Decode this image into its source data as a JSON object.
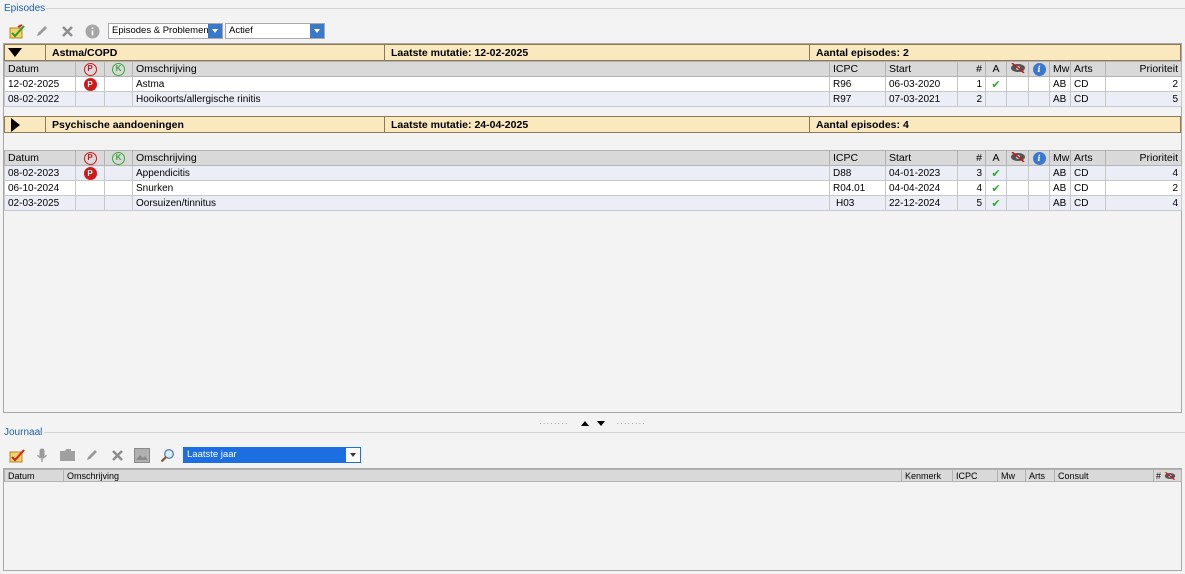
{
  "episodes_section": {
    "title": "Episodes",
    "toolbar": {
      "icons": [
        "new-episode-icon",
        "edit-pencil-icon",
        "delete-x-icon",
        "info-grey-icon"
      ],
      "filter_type": "Episodes & Problemen",
      "filter_status": "Actief"
    },
    "columns": {
      "datum": "Datum",
      "p": "P",
      "k": "K",
      "omschrijving": "Omschrijving",
      "icpc": "ICPC",
      "start": "Start",
      "num": "#",
      "a": "A",
      "mw": "Mw",
      "arts": "Arts",
      "prioriteit": "Prioriteit"
    },
    "groups": [
      {
        "name": "Astma/COPD",
        "expanded": true,
        "mutatie_label": "Laatste mutatie:",
        "mutatie_date": "12-02-2025",
        "aantal_label": "Aantal episodes:",
        "aantal": "2"
      },
      {
        "name": "Psychische aandoeningen",
        "expanded": false,
        "mutatie_label": "Laatste mutatie:",
        "mutatie_date": "24-04-2025",
        "aantal_label": "Aantal episodes:",
        "aantal": "4"
      }
    ],
    "rows_group1": [
      {
        "datum": "12-02-2025",
        "p": "P",
        "omschrijving": "Astma",
        "icpc": "R96",
        "start": "06-03-2020",
        "num": "1",
        "a": "✔",
        "mw": "AB",
        "arts": "CD",
        "prioriteit": "2"
      },
      {
        "datum": "08-02-2022",
        "p": "",
        "omschrijving": "Hooikoorts/allergische rinitis",
        "icpc": "R97",
        "start": "07-03-2021",
        "num": "2",
        "a": "",
        "mw": "AB",
        "arts": "CD",
        "prioriteit": "5"
      }
    ],
    "rows_group2": [
      {
        "datum": "08-02-2023",
        "p": "P",
        "omschrijving": "Appendicitis",
        "icpc": "D88",
        "start": "04-01-2023",
        "num": "3",
        "a": "✔",
        "mw": "AB",
        "arts": "CD",
        "prioriteit": "4"
      },
      {
        "datum": "06-10-2024",
        "p": "",
        "omschrijving": "Snurken",
        "icpc": "R04.01",
        "start": "04-04-2024",
        "num": "4",
        "a": "✔",
        "mw": "AB",
        "arts": "CD",
        "prioriteit": "2"
      },
      {
        "datum": "02-03-2025",
        "p": "",
        "omschrijving": "Oorsuizen/tinnitus",
        "icpc": "H03",
        "start": "22-12-2024",
        "num": "5",
        "a": "✔",
        "mw": "AB",
        "arts": "CD",
        "prioriteit": "4"
      }
    ]
  },
  "journaal_section": {
    "title": "Journaal",
    "toolbar": {
      "icons": [
        "new-entry-icon",
        "microphone-icon",
        "folder-icon",
        "edit-pencil-icon",
        "delete-x-icon",
        "image-icon",
        "search-icon"
      ],
      "period_filter": "Laatste jaar"
    },
    "columns": {
      "datum": "Datum",
      "omschrijving": "Omschrijving",
      "kenmerk": "Kenmerk",
      "icpc": "ICPC",
      "mw": "Mw",
      "arts": "Arts",
      "consult": "Consult",
      "num": "#"
    }
  },
  "colors": {
    "group_bar": "#fae8bf",
    "header": "#d9d9d9",
    "alt_row": "#eceef7",
    "accent_blue": "#1d6ee0",
    "badge_red": "#d01818",
    "badge_green": "#3aa83a",
    "check_green": "#2faa2a"
  }
}
